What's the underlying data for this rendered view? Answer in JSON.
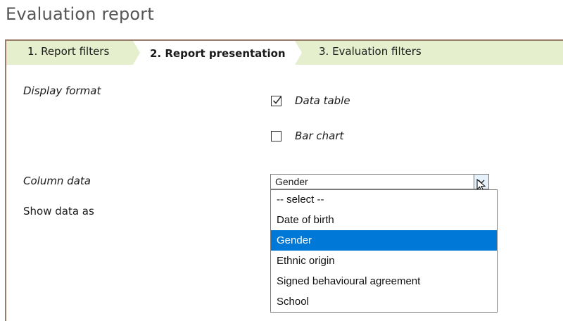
{
  "page": {
    "title": "Evaluation report"
  },
  "tabs": [
    {
      "label": "1. Report filters"
    },
    {
      "label": "2. Report presentation",
      "active": true
    },
    {
      "label": "3. Evaluation filters"
    }
  ],
  "display_format": {
    "label": "Display format",
    "options": [
      {
        "label": "Data table",
        "checked": true
      },
      {
        "label": "Bar chart",
        "checked": false
      }
    ]
  },
  "column_data": {
    "label": "Column data",
    "selected_value": "Gender",
    "options": [
      {
        "label": "-- select --"
      },
      {
        "label": "Date of birth"
      },
      {
        "label": "Gender",
        "highlighted": true
      },
      {
        "label": "Ethnic origin"
      },
      {
        "label": "Signed behavioural agreement"
      },
      {
        "label": "School"
      }
    ]
  },
  "show_data_as": {
    "label": "Show data as"
  },
  "colors": {
    "tab_bar": "#e6efcd",
    "panel_border": "#9a7b6a",
    "highlight": "#0078d7",
    "arrow_button": "#e5f1fb"
  },
  "icons": {
    "checkmark": "check-icon",
    "dropdown_arrow": "chevron-down-icon",
    "cursor": "mouse-pointer-icon"
  }
}
